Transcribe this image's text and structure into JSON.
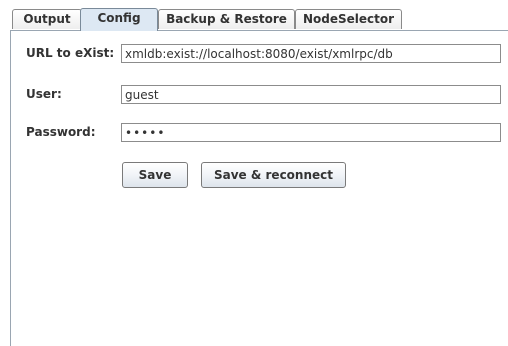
{
  "tabs": {
    "output": "Output",
    "config": "Config",
    "backup": "Backup & Restore",
    "nodeselector": "NodeSelector",
    "selected": "Config"
  },
  "form": {
    "url_label": "URL to eXist:",
    "url_value": "xmldb:exist://localhost:8080/exist/xmlrpc/db",
    "user_label": "User:",
    "user_value": "guest",
    "password_label": "Password:",
    "password_value": "•••••"
  },
  "buttons": {
    "save": "Save",
    "save_reconnect": "Save & reconnect"
  },
  "colors": {
    "selected_tab": "#dde8f3",
    "border": "#8c8c8c",
    "text": "#333333"
  }
}
